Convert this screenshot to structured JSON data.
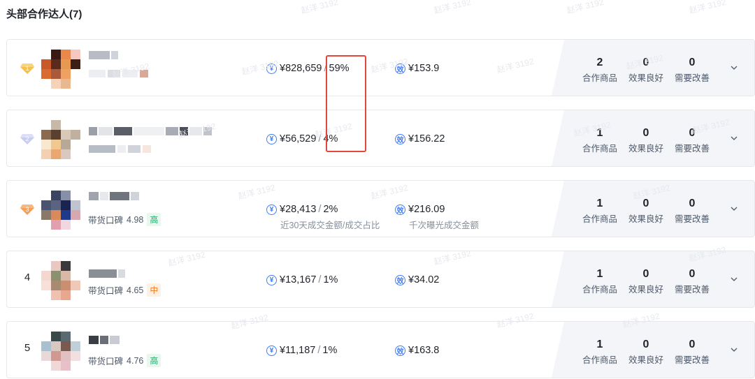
{
  "section": {
    "title": "头部合作达人(7)"
  },
  "watermark_text": "赵洋 3192",
  "stat_labels": {
    "products": "合作商品",
    "good": "效果良好",
    "improve": "需要改善"
  },
  "icons": {
    "amount": "yen-coin-icon",
    "efficiency": "efficiency-coin-icon",
    "expand": "chevron-down-icon"
  },
  "colors": {
    "accent_blue": "#3e7bfa",
    "highlight_red": "#e3463b",
    "good_green": "#17b26a",
    "mid_orange": "#f07a22"
  },
  "creators": [
    {
      "rank": "1",
      "rank_style": "gold-diamond",
      "reputation_label": "",
      "reputation_score": "",
      "reputation_level": "",
      "gmv": "¥828,659",
      "share": "59%",
      "per_thousand": "¥153.9",
      "products": "2",
      "good": "0",
      "improve": "0"
    },
    {
      "rank": "2",
      "rank_style": "silver-diamond",
      "reputation_label": "",
      "reputation_score": "",
      "reputation_level": "",
      "gmv": "¥56,529",
      "share": "4%",
      "per_thousand": "¥156.22",
      "products": "1",
      "good": "0",
      "improve": "0"
    },
    {
      "rank": "3",
      "rank_style": "bronze-diamond",
      "reputation_label": "带货口碑",
      "reputation_score": "4.98",
      "reputation_level": "高",
      "gmv": "¥28,413",
      "share": "2%",
      "per_thousand": "¥216.09",
      "gmv_note": "近30天成交金额/成交占比",
      "per_thousand_note": "千次曝光成交金额",
      "products": "1",
      "good": "0",
      "improve": "0"
    },
    {
      "rank": "4",
      "rank_style": "number",
      "reputation_label": "带货口碑",
      "reputation_score": "4.65",
      "reputation_level": "中",
      "gmv": "¥13,167",
      "share": "1%",
      "per_thousand": "¥34.02",
      "products": "1",
      "good": "0",
      "improve": "0"
    },
    {
      "rank": "5",
      "rank_style": "number",
      "reputation_label": "带货口碑",
      "reputation_score": "4.76",
      "reputation_level": "高",
      "gmv": "¥11,187",
      "share": "1%",
      "per_thousand": "¥163.8",
      "products": "1",
      "good": "0",
      "improve": "0"
    }
  ]
}
